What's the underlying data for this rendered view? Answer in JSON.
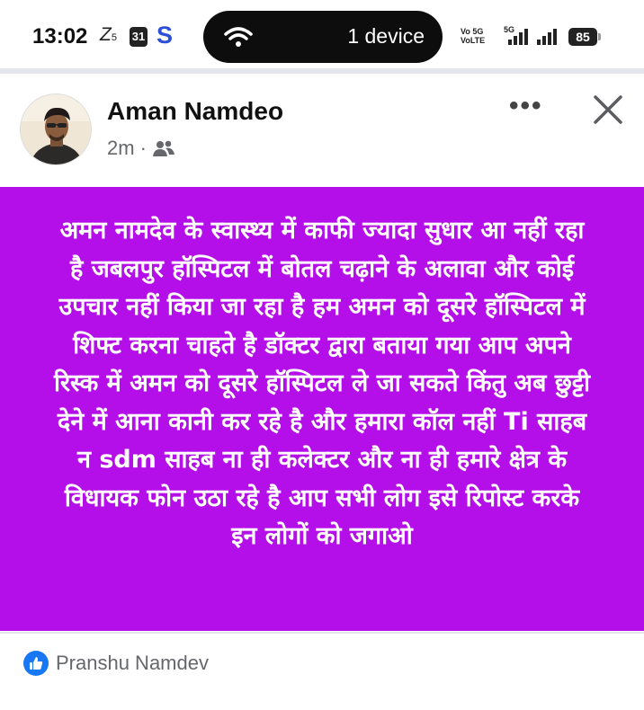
{
  "status_bar": {
    "time": "13:02",
    "z_icon": "Z",
    "z_sub": "5",
    "calendar_day": "31",
    "s_app": "S",
    "device_text": "1 device",
    "network_line1": "Vo 5G",
    "network_line2": "VoLTE",
    "net_5g": "5G",
    "battery": "85"
  },
  "post": {
    "author": "Aman Namdeo",
    "time_ago": "2m",
    "separator": "·",
    "audience_icon": "friends-icon",
    "more_label": "•••",
    "body_text": "अमन नामदेव के स्वास्थ्य में काफी ज्यादा सुधार आ नहीं रहा है जबलपुर हॉस्पिटल में बोतल चढ़ाने के अलावा और कोई उपचार नहीं किया जा रहा है हम अमन को दूसरे हॉस्पिटल में शिफ्ट करना चाहते है डॉक्टर द्वारा बताया गया आप अपने रिस्क में अमन को दूसरे हॉस्पिटल ले जा सकते किंतु अब छुट्टी देने में आना कानी कर रहे है और हमारा कॉल नहीं Ti साहब न sdm साहब ना ही कलेक्टर और ना ही हमारे क्षेत्र के विधायक फोन उठा रहे है आप सभी लोग इसे रिपोस्ट करके इन लोगों को जगाओ",
    "background_color": "#b40fe8",
    "reaction_name": "Pranshu Namdev",
    "reaction_icon": "like-icon"
  }
}
